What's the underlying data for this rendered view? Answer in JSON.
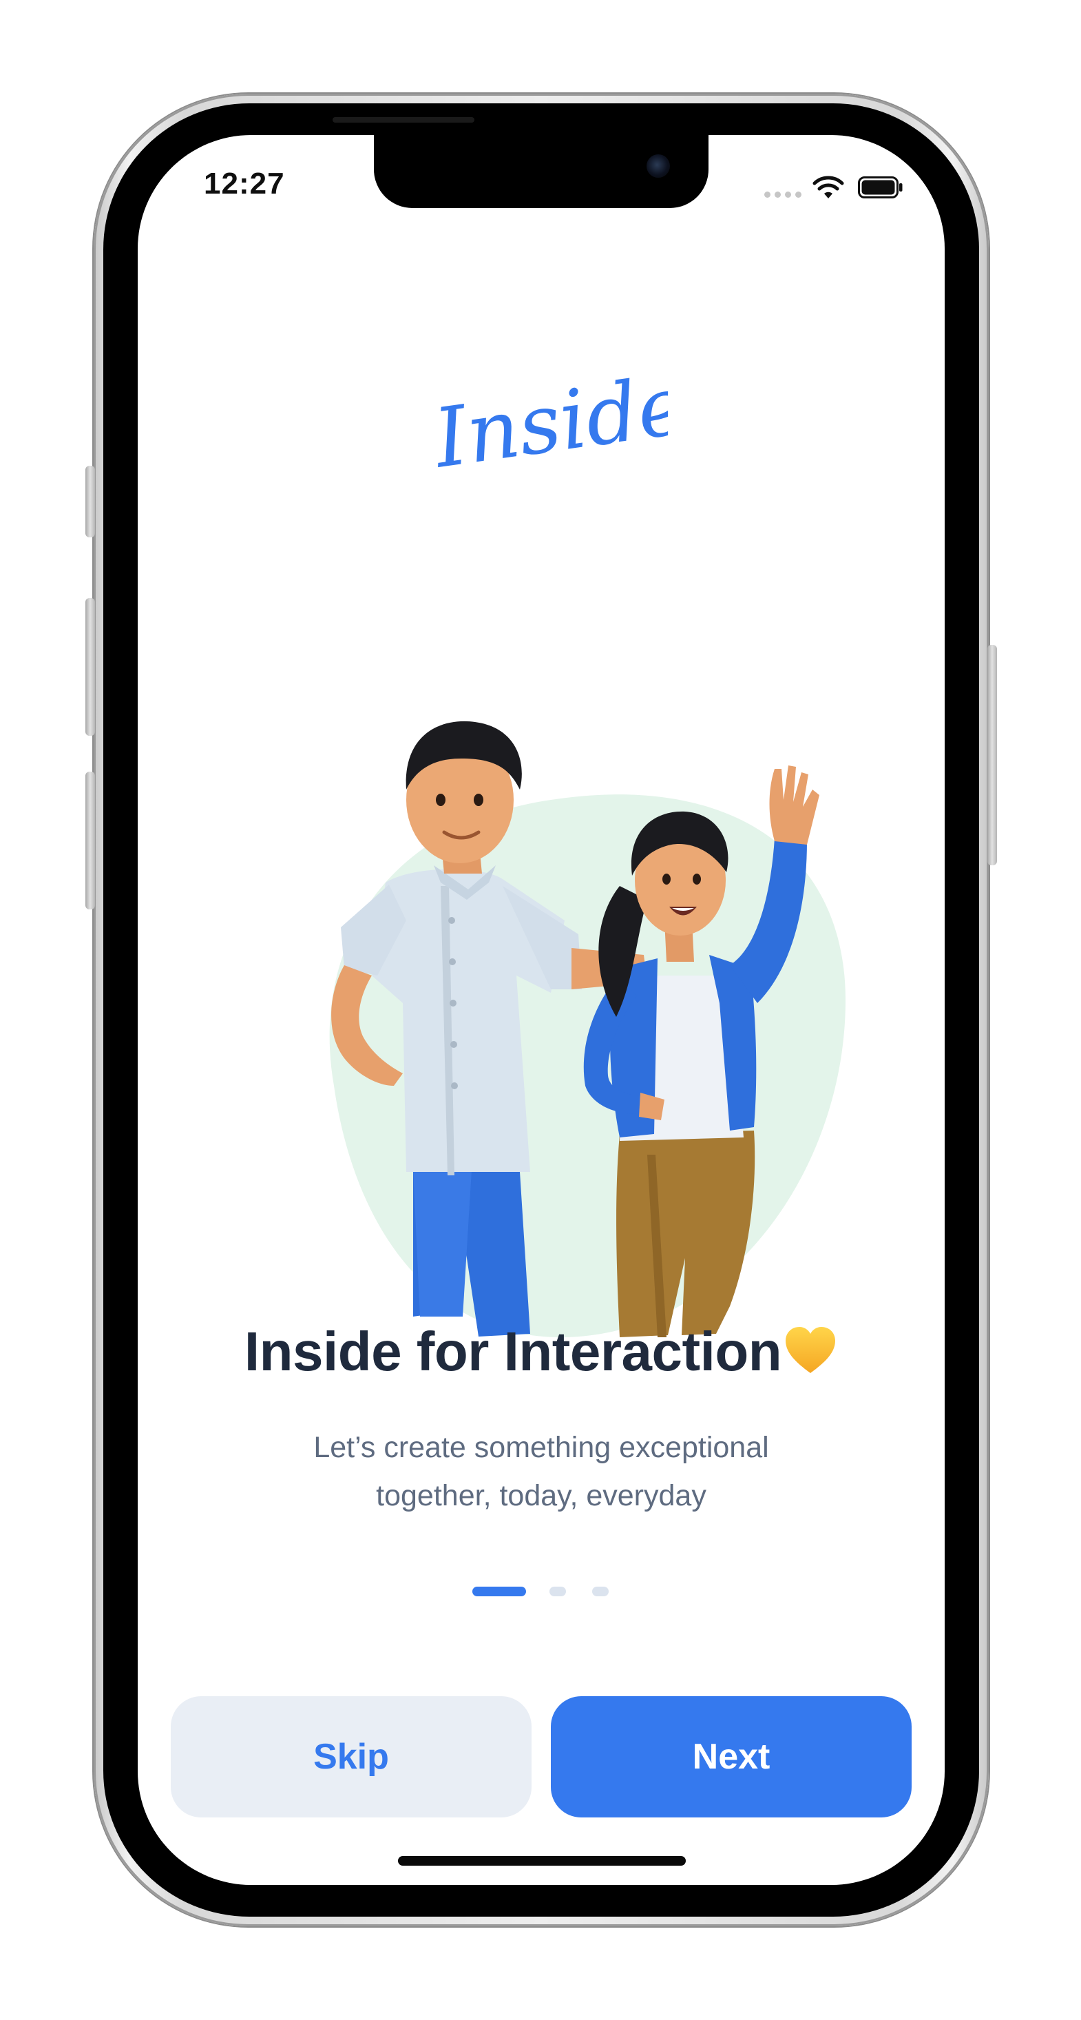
{
  "status_bar": {
    "time": "12:27"
  },
  "logo": {
    "text": "Inside"
  },
  "onboarding": {
    "headline": "Inside for Interaction",
    "headline_emoji": "yellow-heart-icon",
    "subtitle_line1": "Let’s create something exceptional",
    "subtitle_line2": "together, today, everyday",
    "page_index": 1,
    "page_count": 3
  },
  "actions": {
    "skip_label": "Skip",
    "next_label": "Next"
  },
  "colors": {
    "accent": "#3579ee",
    "headline": "#1f2a3d",
    "subtitle": "#5e6b80",
    "blob": "#e3f4ea",
    "skip_bg": "#e9eef5"
  }
}
